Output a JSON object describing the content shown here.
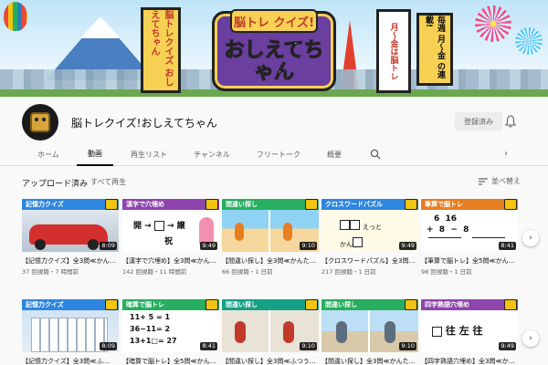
{
  "banner": {
    "logo_top": "脳トレ クイズ!",
    "logo_main": "おしえてちゃん",
    "scroll_left": "脳トレクイズ おしえてちゃん",
    "scroll_right": "月〜金は脳トレ",
    "scroll_right2": "毎週 月〜金 の連載!"
  },
  "channel": {
    "name": "脳トレクイズ!おしえてちゃん",
    "subscribe_label": "登録済み"
  },
  "tabs": [
    {
      "label": "ホーム"
    },
    {
      "label": "動画"
    },
    {
      "label": "再生リスト"
    },
    {
      "label": "チャンネル"
    },
    {
      "label": "フリートーク"
    },
    {
      "label": "概要"
    }
  ],
  "section": {
    "title": "アップロード済み",
    "play_all": "すべて再生",
    "sort_label": "並べ替え"
  },
  "videos": [
    {
      "strip": "記憶力クイズ",
      "duration": "8:09",
      "title": "【記憶力クイズ】全3問≪かんたん≫(フリー)脳トレ…",
      "meta": "37 回視聴・7 時間前",
      "color": "#2e86de"
    },
    {
      "strip": "漢字で穴埋め",
      "duration": "9:49",
      "title": "【漢字で穴埋め】全3問≪かんたん≫(フリー)脳トレ…",
      "meta": "142 回視聴・11 時間前",
      "color": "#8e44ad"
    },
    {
      "strip": "間違い探し",
      "duration": "9:10",
      "title": "【間違い探し】全3問≪かんたん≫(フリー)脳トレク…",
      "meta": "66 回視聴・1 日前",
      "color": "#27ae60"
    },
    {
      "strip": "クロスワードパズル",
      "duration": "9:49",
      "title": "【クロスワードパズル】全3問≪かんたん≫(フリー)…",
      "meta": "217 回視聴・1 日前",
      "color": "#2e86de"
    },
    {
      "strip": "筆算で脳トレ",
      "duration": "8:41",
      "title": "【筆算で脳トレ】全5問≪かんたん≫脳トレクイズ 高…",
      "meta": "98 回視聴・1 日前",
      "color": "#e67e22"
    },
    {
      "strip": "記憶力クイズ",
      "duration": "8:09",
      "title": "【記憶力クイズ】全3問≪ふ…",
      "meta": "",
      "color": "#2e86de"
    },
    {
      "strip": "暗算で脳トレ",
      "duration": "8:41",
      "title": "【暗算で脳トレ】全5問≪かんたん≫…",
      "meta": "",
      "color": "#27ae60"
    },
    {
      "strip": "間違い探し",
      "duration": "9:10",
      "title": "【間違い探し】全3問≪ふつう…",
      "meta": "",
      "color": "#16a085"
    },
    {
      "strip": "間違い探し",
      "duration": "9:10",
      "title": "【間違い探し】全3問≪かんたん…",
      "meta": "",
      "color": "#27ae60"
    },
    {
      "strip": "四字熟語穴埋め",
      "duration": "9:49",
      "title": "【四字熟語穴埋め】全3問≪かん…",
      "meta": "",
      "color": "#8e44ad"
    }
  ],
  "thumb_text": {
    "kanji_q": "開",
    "kanji_q2": "譲",
    "kanji_q3": "祝",
    "cross_a": "えっと",
    "cross_b": "かん",
    "hissan_l1": "6  16",
    "hissan_l2": "+  8  −  8",
    "anzan_l1": "11+ 5 = 1",
    "anzan_l2": "36−11= 2",
    "anzan_l3": "13+1□= 27",
    "yoji": "往 左 往"
  }
}
